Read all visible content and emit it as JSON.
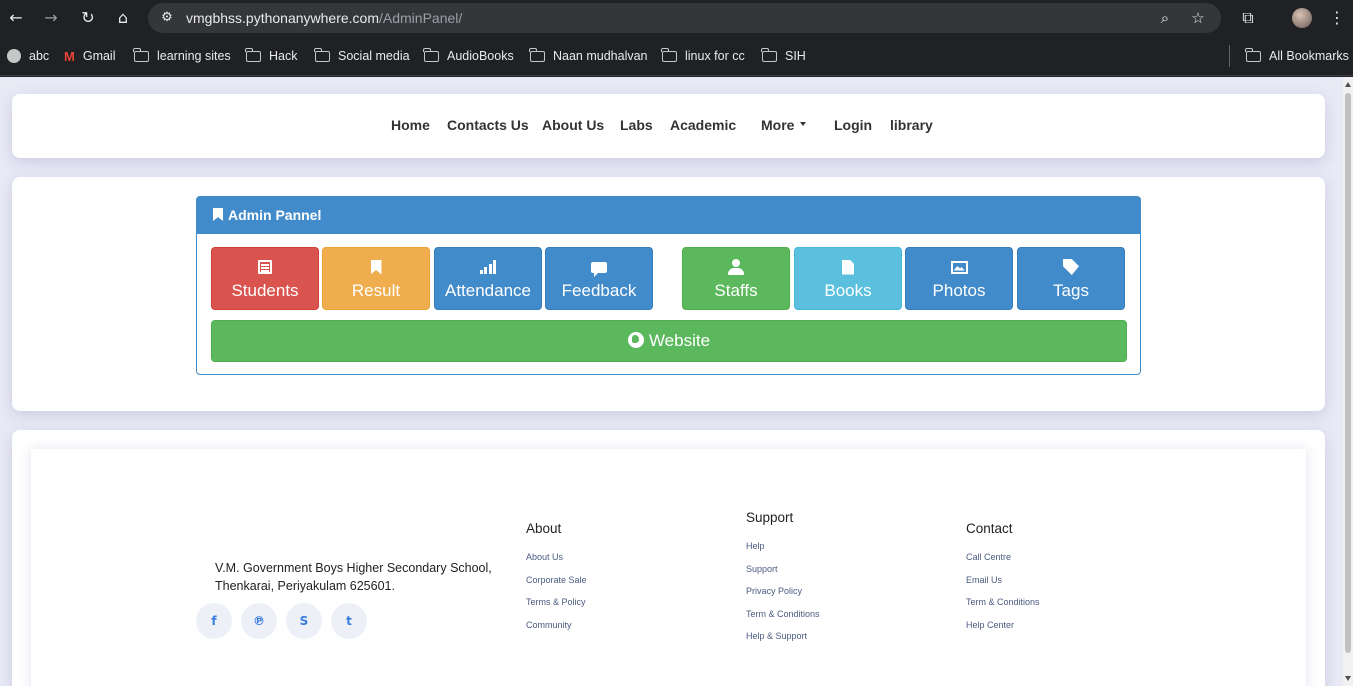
{
  "browser": {
    "url_host": "vmgbhss.pythonanywhere.com",
    "url_path": "/AdminPanel/",
    "bookmarks": [
      "abc",
      "Gmail",
      "learning sites",
      "Hack",
      "Social media",
      "AudioBooks",
      "Naan mudhalvan",
      "linux for cc",
      "SIH"
    ],
    "all_bookmarks": "All Bookmarks"
  },
  "nav": {
    "items": [
      "Home",
      "Contacts Us",
      "About Us",
      "Labs",
      "Academic",
      "More",
      "Login",
      "library"
    ]
  },
  "panel": {
    "title": "Admin Pannel",
    "tiles": [
      {
        "label": "Students",
        "icon": "list-icon"
      },
      {
        "label": "Result",
        "icon": "bookmark-icon"
      },
      {
        "label": "Attendance",
        "icon": "signal-icon"
      },
      {
        "label": "Feedback",
        "icon": "comment-icon"
      },
      {
        "label": "Staffs",
        "icon": "user-icon"
      },
      {
        "label": "Books",
        "icon": "file-icon"
      },
      {
        "label": "Photos",
        "icon": "picture-icon"
      },
      {
        "label": "Tags",
        "icon": "tag-icon"
      }
    ],
    "website_label": "Website"
  },
  "footer": {
    "address_line1": "V.M. Government Boys Higher Secondary School,",
    "address_line2": "Thenkarai, Periyakulam 625601.",
    "social": [
      "facebook-icon",
      "pinterest-icon",
      "skype-icon",
      "twitter-icon"
    ],
    "columns": [
      {
        "heading": "About",
        "links": [
          "About Us",
          "Corporate Sale",
          "Terms & Policy",
          "Community"
        ]
      },
      {
        "heading": "Support",
        "links": [
          "Help",
          "Support",
          "Privacy Policy",
          "Term & Conditions",
          "Help & Support"
        ]
      },
      {
        "heading": "Contact",
        "links": [
          "Call Centre",
          "Email Us",
          "Term & Conditions",
          "Help Center"
        ]
      }
    ]
  },
  "colors": {
    "primary": "#428bca",
    "danger": "#d9534f",
    "warning": "#f0ad4e",
    "success": "#5cb85c",
    "info": "#5bc0de"
  }
}
